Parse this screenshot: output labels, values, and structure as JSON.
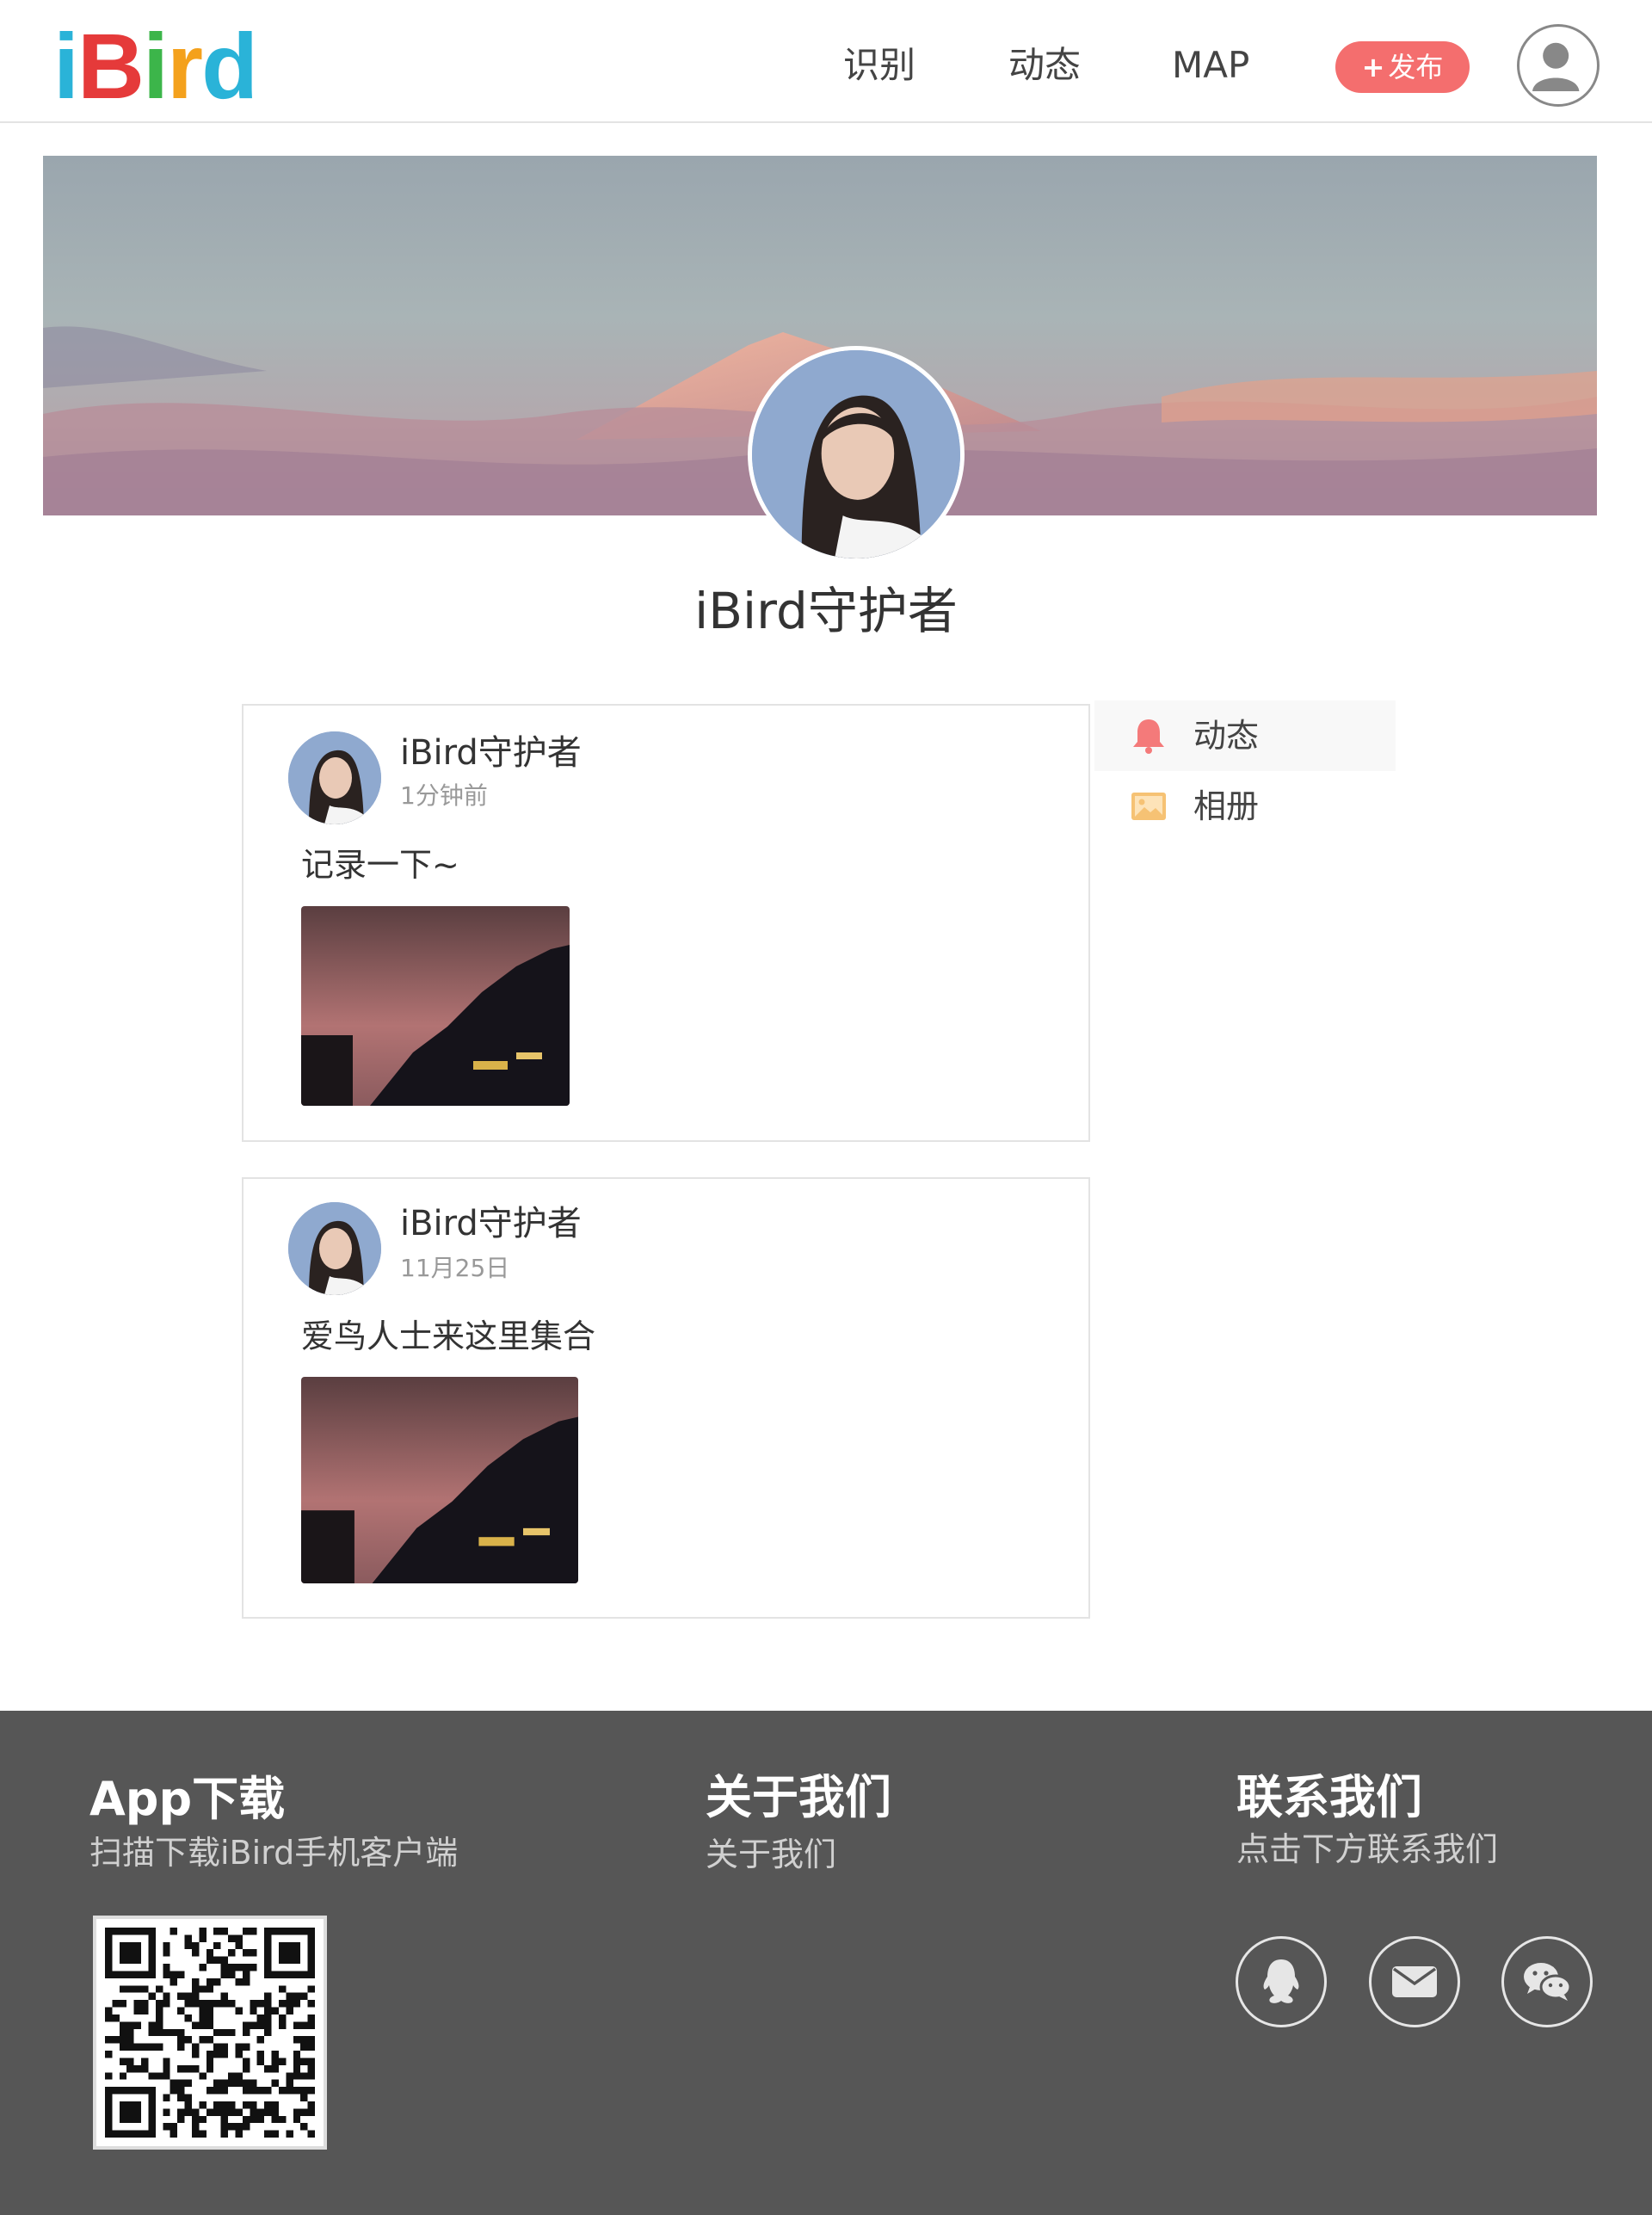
{
  "header": {
    "logo_letters": [
      "i",
      "B",
      "i",
      "r",
      "d"
    ],
    "logo_colors": [
      "#2ab3d8",
      "#e53a3a",
      "#3cb54a",
      "#f4a11c",
      "#2ab3d8"
    ],
    "nav": [
      "识别",
      "动态",
      "MAP"
    ],
    "publish_plus": "+",
    "publish_label": "发布",
    "user_icon": "user-avatar-icon"
  },
  "profile": {
    "name": "iBird守护者",
    "banner": "mountain-sunset-banner"
  },
  "posts": [
    {
      "user": "iBird守护者",
      "time": "1分钟前",
      "text": "记录一下~",
      "photo": "evening-sky-buildings-photo"
    },
    {
      "user": "iBird守护者",
      "time": "11月25日",
      "text": "爱鸟人士来这里集合",
      "photo": "evening-sky-buildings-photo"
    }
  ],
  "side_menu": [
    {
      "label": "动态",
      "icon": "bell-icon",
      "color": "#f47a7a",
      "active": true
    },
    {
      "label": "相册",
      "icon": "image-icon",
      "color": "#f6c274",
      "active": false
    }
  ],
  "footer": {
    "app": {
      "title": "App下载",
      "subtitle": "扫描下载iBird手机客户端",
      "qr": "qr-code"
    },
    "about": {
      "title": "关于我们",
      "link": "关于我们"
    },
    "contact": {
      "title": "联系我们",
      "subtitle": "点击下方联系我们",
      "icons": [
        "qq-icon",
        "mail-icon",
        "wechat-icon"
      ]
    },
    "background": "#565656"
  },
  "colors": {
    "accent": "#f46e6e",
    "border": "#e3e3e3"
  }
}
